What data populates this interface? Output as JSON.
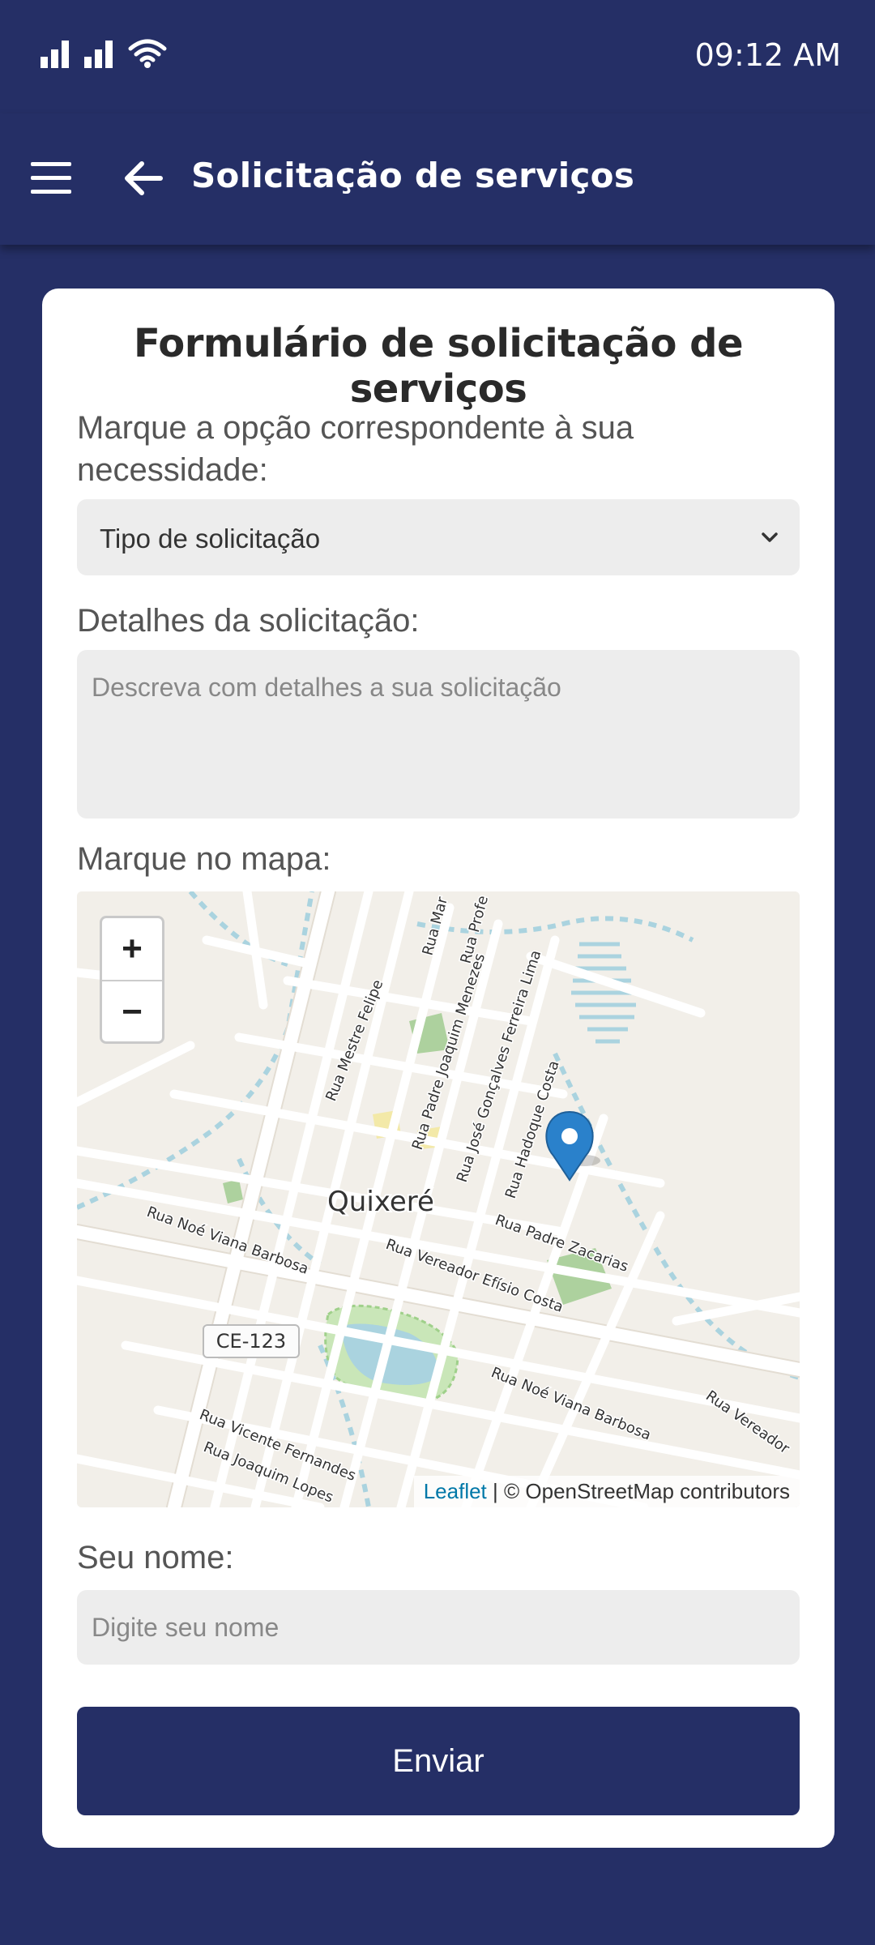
{
  "status_bar": {
    "time": "09:12 AM"
  },
  "app_bar": {
    "title": "Solicitação de serviços"
  },
  "form": {
    "title": "Formulário de solicitação de serviços",
    "type_label": "Marque a opção correspondente à sua necessidade:",
    "type_select_value": "Tipo de solicitação",
    "details_label": "Detalhes da solicitação:",
    "details_placeholder": "Descreva com detalhes a sua solicitação",
    "map_label": "Marque no mapa:",
    "name_label": "Seu nome:",
    "name_placeholder": "Digite seu nome",
    "submit_label": "Enviar"
  },
  "map": {
    "zoom_in": "+",
    "zoom_out": "−",
    "city_label": "Quixeré",
    "road_shield": "CE-123",
    "attribution_link": "Leaflet",
    "attribution_text": " | © OpenStreetMap contributors",
    "street_labels": [
      "Rua Mar",
      "Rua Profe",
      "Rua Mestre Felipe",
      "Rua Padre Joaquim Menezes",
      "Rua José Gonçalves Ferreira Lima",
      "Rua Hadoque Costa",
      "Rua Noé Viana Barbosa",
      "Rua Padre Zacarias",
      "Rua Vereador Efísio Costa",
      "Rua Noé Viana Barbosa",
      "Rua Vereador",
      "Rua Vicente Fernandes",
      "Rua Joaquim Lopes"
    ],
    "colors": {
      "land": "#f2efe9",
      "road": "#ffffff",
      "water": "#aad3df",
      "park": "#add19e",
      "marker": "#2a81cb"
    }
  },
  "colors": {
    "primary": "#252f66",
    "input_bg": "#ededed",
    "card_bg": "#ffffff"
  }
}
